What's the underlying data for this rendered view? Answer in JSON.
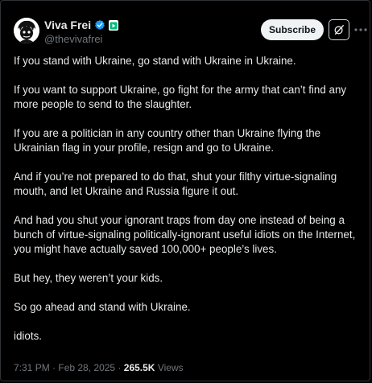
{
  "author": {
    "display_name": "Viva Frei",
    "handle": "@thevivafrei"
  },
  "actions": {
    "subscribe_label": "Subscribe",
    "grok_icon": "grok-slash-icon",
    "more_icon": "more-dots-icon"
  },
  "post": {
    "paragraphs": [
      "If you stand with Ukraine, go stand with Ukraine in Ukraine.",
      "If you want to support Ukraine, go fight for the army that can’t find any more people to send to the slaughter.",
      "If you are a politician in any country other than Ukraine flying the Ukrainian flag in your profile, resign and go to Ukraine.",
      "And if you’re not prepared to do that, shut your filthy virtue-signaling mouth, and let Ukraine and Russia figure it out.",
      "And had you shut your ignorant traps from day one instead of being a bunch of virtue-signaling politically-ignorant useful idiots on the Internet, you might have actually saved 100,000+ people’s lives.",
      "But hey, they weren’t your kids.",
      "So go ahead and stand with Ukraine.",
      "idiots."
    ]
  },
  "meta": {
    "time": "7:31 PM",
    "separator1": " · ",
    "date": "Feb 28, 2025",
    "separator2": " · ",
    "views_count": "265.5K",
    "views_label": " Views"
  },
  "colors": {
    "background": "#000000",
    "text": "#e7e9ea",
    "muted": "#71767b",
    "verified": "#1d9bf0",
    "affiliate_badge": "#00ba7c"
  }
}
